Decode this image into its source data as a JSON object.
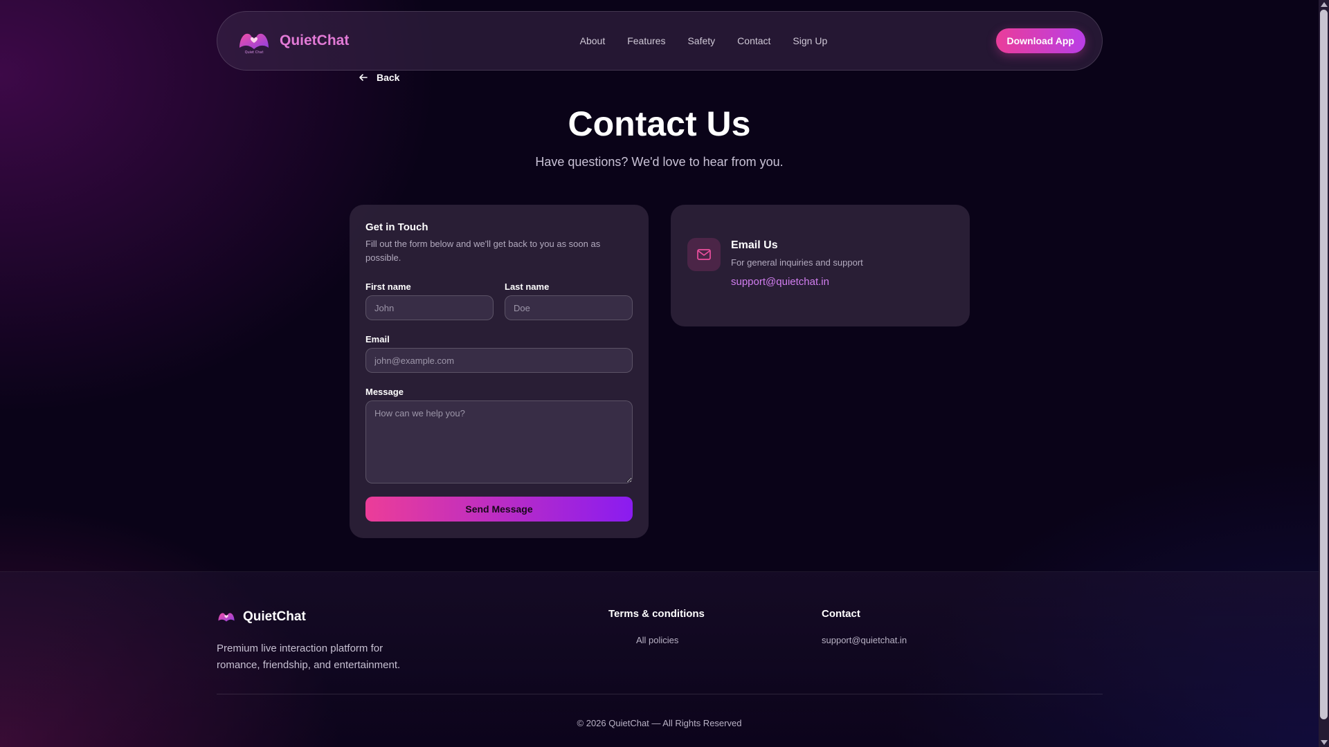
{
  "nav": {
    "brand": "QuietChat",
    "links": [
      "About",
      "Features",
      "Safety",
      "Contact",
      "Sign Up"
    ],
    "cta": "Download App"
  },
  "back_label": "Back",
  "page": {
    "title": "Contact Us",
    "subtitle": "Have questions? We'd love to hear from you."
  },
  "form": {
    "title": "Get in Touch",
    "description": "Fill out the form below and we'll get back to you as soon as possible.",
    "first_name_label": "First name",
    "first_name_placeholder": "John",
    "last_name_label": "Last name",
    "last_name_placeholder": "Doe",
    "email_label": "Email",
    "email_placeholder": "john@example.com",
    "message_label": "Message",
    "message_placeholder": "How can we help you?",
    "submit_label": "Send Message"
  },
  "info": {
    "title": "Email Us",
    "description": "For general inquiries and support",
    "email": "support@quietchat.in",
    "icon": "mail-icon"
  },
  "footer": {
    "brand": "QuietChat",
    "tagline": "Premium live interaction platform for romance, friendship, and entertainment.",
    "terms_title": "Terms & conditions",
    "terms_link": "All policies",
    "contact_title": "Contact",
    "contact_email": "support@quietchat.in",
    "copyright": "© 2026 QuietChat — All Rights Reserved"
  },
  "colors": {
    "accent_pink": "#ea3d9a",
    "accent_purple": "#8a1cf0",
    "brand_text": "#e27ad6",
    "link": "#d27ef0"
  }
}
